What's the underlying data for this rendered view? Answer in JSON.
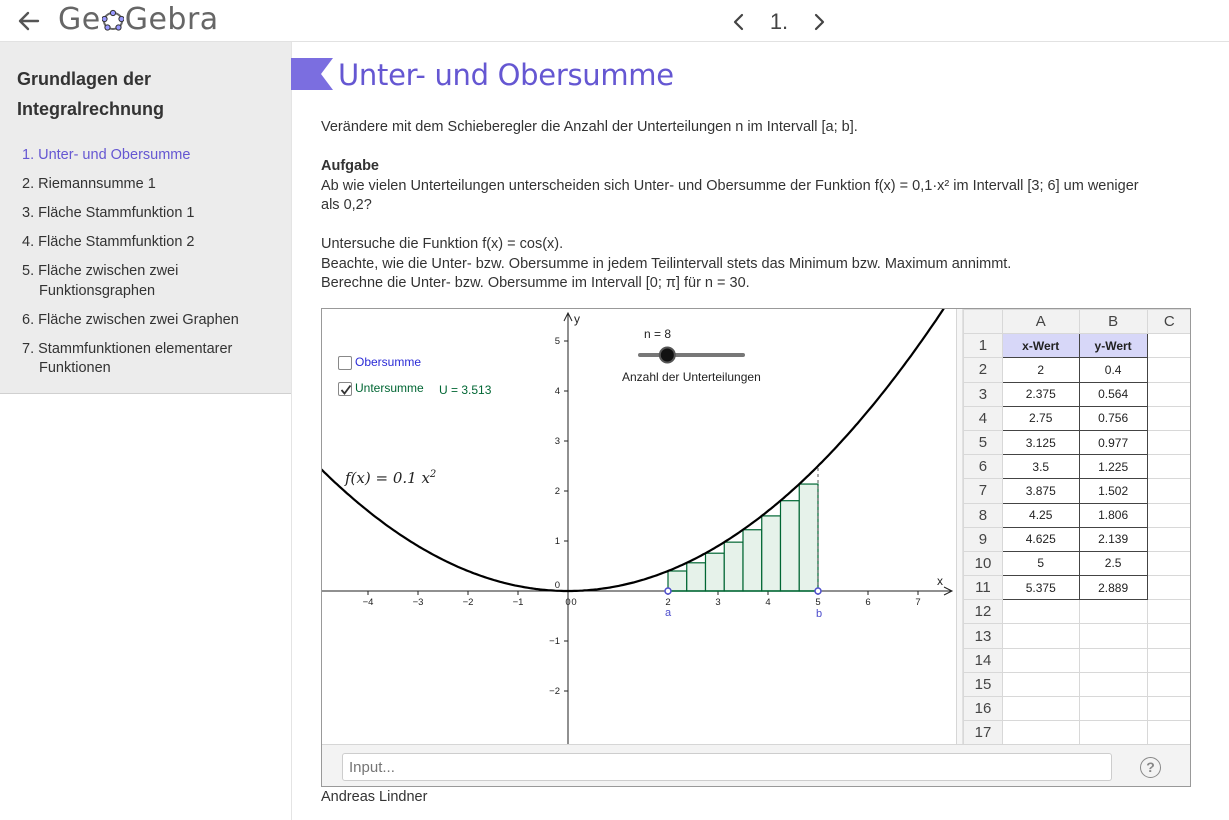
{
  "header": {
    "logo_part1": "Ge",
    "logo_part2": "Gebra",
    "page_number": "1."
  },
  "sidebar": {
    "book_title": "Grundlagen der Integralrechnung",
    "items": [
      {
        "label": "1. Unter- und Obersumme",
        "active": true
      },
      {
        "label": "2. Riemannsumme 1"
      },
      {
        "label": "3. Fläche Stammfunktion 1"
      },
      {
        "label": "4. Fläche Stammfunktion 2"
      },
      {
        "label": "5. Fläche zwischen zwei Funktionsgraphen"
      },
      {
        "label": "6. Fläche zwischen zwei Graphen"
      },
      {
        "label": "7. Stammfunktionen elementarer Funktionen"
      }
    ]
  },
  "main": {
    "title": "Unter- und Obersumme",
    "intro": "Verändere mit dem Schieberegler die Anzahl der Unterteilungen n im Intervall [a; b].",
    "task_heading": "Aufgabe",
    "task_line1": "Ab wie vielen Unterteilungen unterscheiden sich Unter- und Obersumme der Funktion f(x) = 0,1·x² im Intervall [3; 6] um weniger",
    "task_line2": "als 0,2?",
    "para_line1": "Untersuche die Funktion f(x) = cos(x).",
    "para_line2": "Beachte, wie die Unter- bzw. Obersumme in jedem Teilintervall stets das Minimum bzw. Maximum annimmt.",
    "para_line3": "Berechne die Unter- bzw. Obersumme im Intervall [0; π] für n = 30.",
    "author": "Andreas Lindner"
  },
  "applet": {
    "checkbox_obersumme": {
      "label": "Obersumme",
      "checked": false
    },
    "checkbox_untersumme": {
      "label": "Untersumme",
      "checked": true
    },
    "u_value": "U = 3.513",
    "slider_label": "n = 8",
    "slider_value": 8,
    "slider_caption": "Anzahl der Unterteilungen",
    "function_label": "f(x)  =  0.1 x",
    "function_exponent": "2",
    "point_a": "a",
    "point_b": "b",
    "axis_x": "x",
    "axis_y": "y",
    "input_placeholder": "Input...",
    "help": "?",
    "colors": {
      "under_sum": "#006633",
      "fill": "#e6f2ea",
      "curve": "#000000",
      "point": "#4d4dcc"
    }
  },
  "chart_data": {
    "type": "line",
    "function": "f(x) = 0.1 x^2",
    "interval": [
      2,
      5
    ],
    "n": 8,
    "x_ticks": [
      -4,
      -3,
      -2,
      -1,
      0,
      2,
      3,
      4,
      5,
      6,
      7
    ],
    "y_ticks": [
      -2,
      -1,
      1,
      2,
      3,
      4,
      5
    ],
    "xlim": [
      -5,
      7.7
    ],
    "ylim": [
      -3,
      5.6
    ],
    "lower_sum_bars": [
      {
        "x0": 2,
        "x1": 2.375,
        "height": 0.4
      },
      {
        "x0": 2.375,
        "x1": 2.75,
        "height": 0.564
      },
      {
        "x0": 2.75,
        "x1": 3.125,
        "height": 0.756
      },
      {
        "x0": 3.125,
        "x1": 3.5,
        "height": 0.977
      },
      {
        "x0": 3.5,
        "x1": 3.875,
        "height": 1.225
      },
      {
        "x0": 3.875,
        "x1": 4.25,
        "height": 1.502
      },
      {
        "x0": 4.25,
        "x1": 4.625,
        "height": 1.806
      },
      {
        "x0": 4.625,
        "x1": 5,
        "height": 2.139
      }
    ]
  },
  "spreadsheet": {
    "columns": [
      "A",
      "B",
      "C"
    ],
    "header_row": [
      "x-Wert",
      "y-Wert"
    ],
    "rows": [
      [
        "2",
        "0.4"
      ],
      [
        "2.375",
        "0.564"
      ],
      [
        "2.75",
        "0.756"
      ],
      [
        "3.125",
        "0.977"
      ],
      [
        "3.5",
        "1.225"
      ],
      [
        "3.875",
        "1.502"
      ],
      [
        "4.25",
        "1.806"
      ],
      [
        "4.625",
        "2.139"
      ],
      [
        "5",
        "2.5"
      ],
      [
        "5.375",
        "2.889"
      ]
    ],
    "row_numbers": [
      "1",
      "2",
      "3",
      "4",
      "5",
      "6",
      "7",
      "8",
      "9",
      "10",
      "11",
      "12",
      "13",
      "14",
      "15",
      "16",
      "17"
    ]
  }
}
